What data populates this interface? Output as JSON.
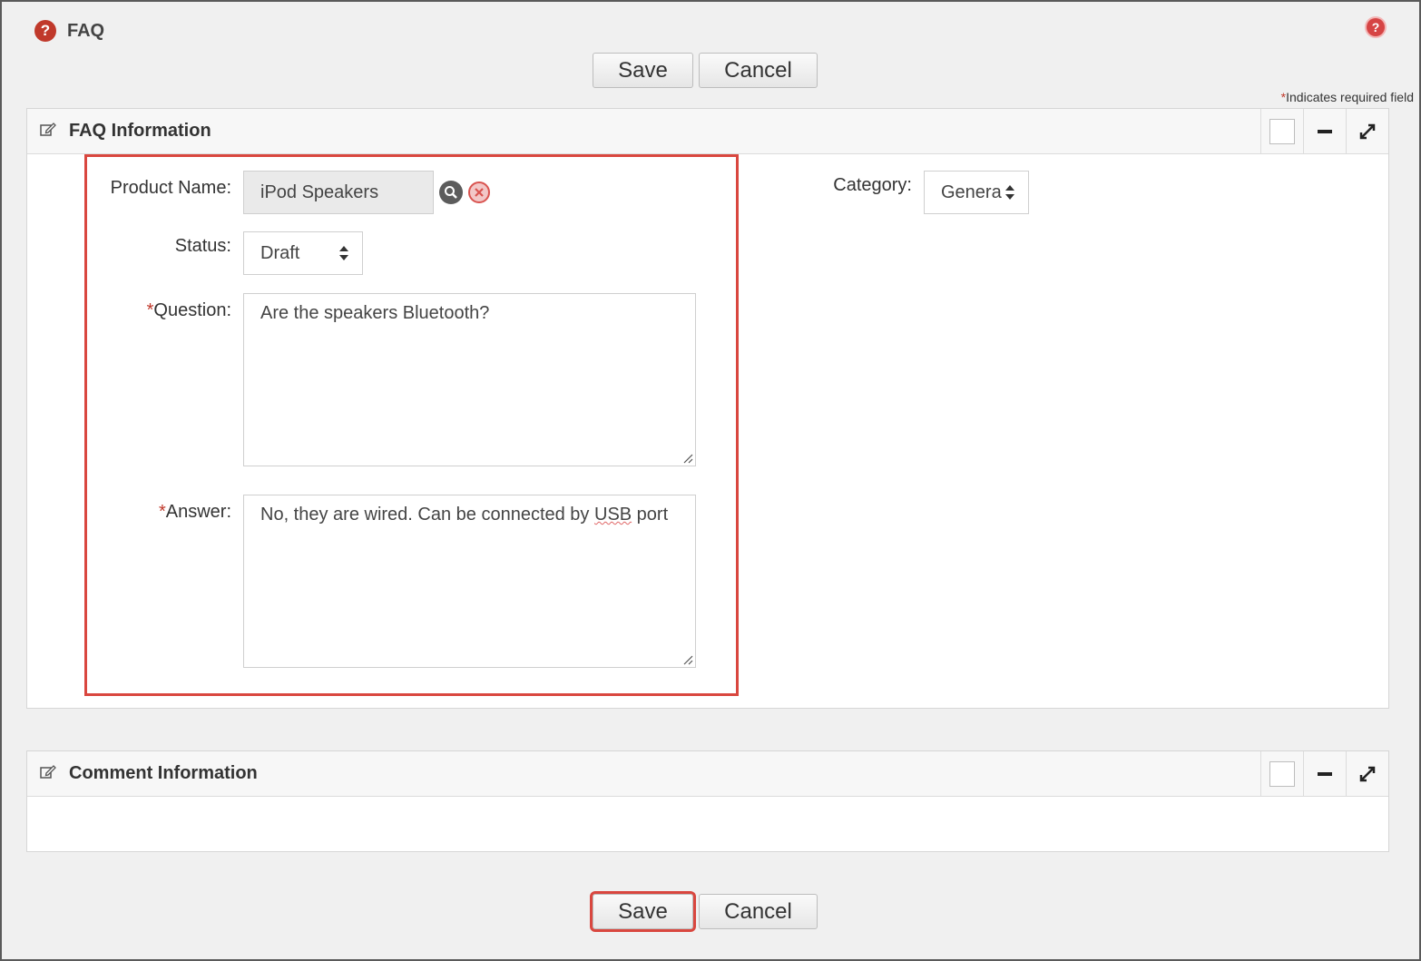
{
  "page": {
    "title": "FAQ",
    "help_glyph": "?"
  },
  "toolbar": {
    "save_label": "Save",
    "cancel_label": "Cancel"
  },
  "required_note": {
    "mark": "*",
    "text": "Indicates required field"
  },
  "faq_panel": {
    "title": "FAQ Information",
    "product_name": {
      "label": "Product Name:",
      "value": "iPod Speakers"
    },
    "status": {
      "label": "Status:",
      "value": "Draft"
    },
    "question": {
      "required_mark": "*",
      "label": "Question:",
      "value": "Are the speakers Bluetooth?"
    },
    "answer": {
      "required_mark": "*",
      "label": "Answer:",
      "value_before": "No, they are wired. Can be connected by ",
      "value_flagged": "USB",
      "value_after": " port"
    },
    "category": {
      "label": "Category:",
      "value": "Genera"
    }
  },
  "comment_panel": {
    "title": "Comment Information"
  },
  "colors": {
    "accent_red": "#d9473f",
    "icon_red": "#c0392b"
  },
  "icons": [
    "question-icon",
    "help-icon",
    "edit-icon",
    "search-icon",
    "clear-icon",
    "minimize-icon",
    "expand-icon",
    "sort-arrows-icon"
  ]
}
